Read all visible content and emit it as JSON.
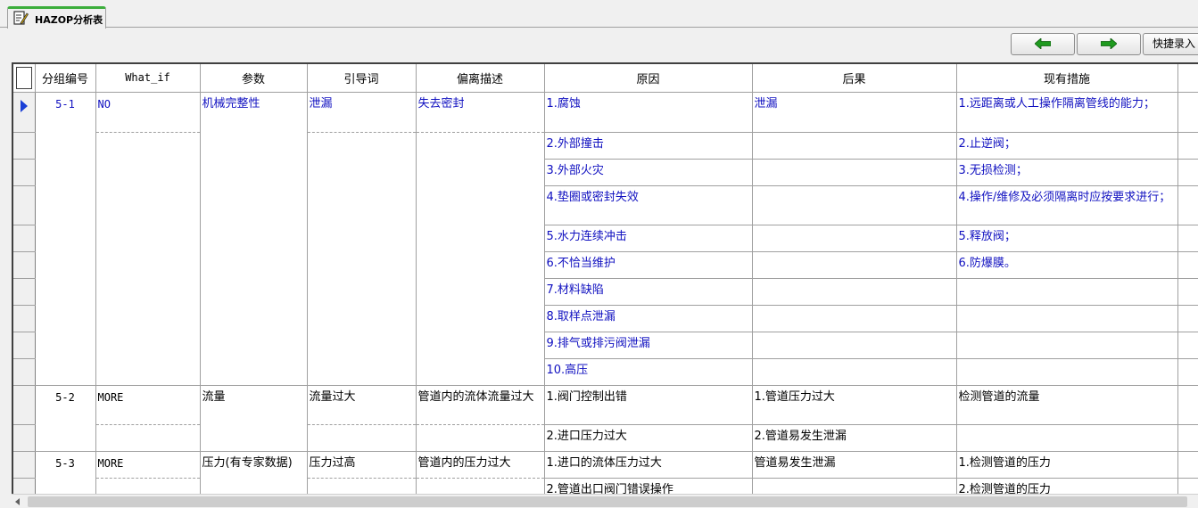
{
  "tab": {
    "label": "HAZOP分析表"
  },
  "toolbar": {
    "quick_entry_label": "快捷录入"
  },
  "grid": {
    "columns": [
      "分组编号",
      "What_if",
      "参数",
      "引导词",
      "偏离描述",
      "原因",
      "后果",
      "现有措施"
    ],
    "groups": [
      {
        "id": "5-1",
        "what_if": "NO",
        "param": "机械完整性",
        "guide": "泄漏",
        "deviation": "失去密封",
        "rows": [
          {
            "cause": "1.腐蚀",
            "consequence": "泄漏",
            "measure": "1.远距离或人工操作隔离管线的能力；"
          },
          {
            "cause": "2.外部撞击",
            "consequence": "",
            "measure": "2.止逆阀；"
          },
          {
            "cause": "3.外部火灾",
            "consequence": "",
            "measure": "3.无损检测；"
          },
          {
            "cause": "4.垫圈或密封失效",
            "consequence": "",
            "measure": "4.操作/维修及必须隔离时应按要求进行；"
          },
          {
            "cause": "5.水力连续冲击",
            "consequence": "",
            "measure": "5.释放阀；"
          },
          {
            "cause": "6.不恰当维护",
            "consequence": "",
            "measure": "6.防爆膜。"
          },
          {
            "cause": "7.材料缺陷",
            "consequence": "",
            "measure": ""
          },
          {
            "cause": "8.取样点泄漏",
            "consequence": "",
            "measure": ""
          },
          {
            "cause": "9.排气或排污阀泄漏",
            "consequence": "",
            "measure": ""
          },
          {
            "cause": "10.高压",
            "consequence": "",
            "measure": ""
          }
        ]
      },
      {
        "id": "5-2",
        "what_if": "MORE",
        "param": "流量",
        "guide": "流量过大",
        "deviation": "管道内的流体流量过大",
        "rows": [
          {
            "cause": "1.阀门控制出错",
            "consequence": "1.管道压力过大",
            "measure": "检测管道的流量"
          },
          {
            "cause": "2.进口压力过大",
            "consequence": "2.管道易发生泄漏",
            "measure": ""
          }
        ]
      },
      {
        "id": "5-3",
        "what_if": "MORE",
        "param": "压力(有专家数据)",
        "guide": "压力过高",
        "deviation": "管道内的压力过大",
        "rows": [
          {
            "cause": "1.进口的流体压力过大",
            "consequence": "管道易发生泄漏",
            "measure": "1.检测管道的压力"
          },
          {
            "cause": "2.管道出口阀门错误操作",
            "consequence": "",
            "measure": "2.检测管道的压力"
          }
        ]
      }
    ]
  }
}
